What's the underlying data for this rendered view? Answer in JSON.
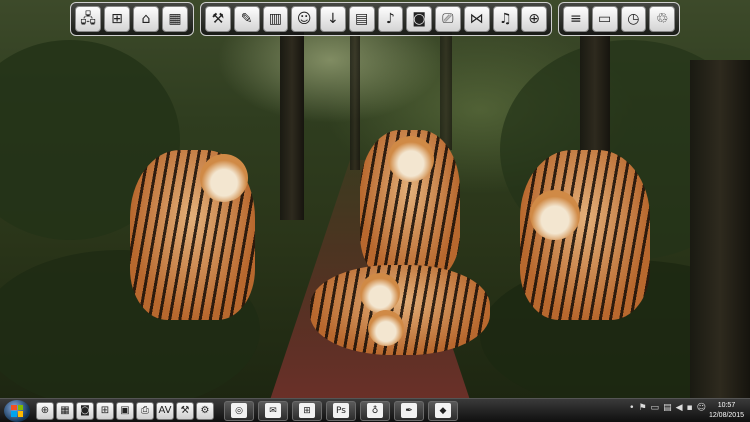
{
  "top_dock": {
    "group1": [
      {
        "name": "computer-icon",
        "glyph": "🖧"
      },
      {
        "name": "network-icon",
        "glyph": "⊞"
      },
      {
        "name": "home-icon",
        "glyph": "⌂"
      },
      {
        "name": "devices-icon",
        "glyph": "▦"
      }
    ],
    "group2": [
      {
        "name": "tools-icon",
        "glyph": "⚒"
      },
      {
        "name": "paint-icon",
        "glyph": "✎"
      },
      {
        "name": "library-icon",
        "glyph": "▥"
      },
      {
        "name": "user-icon",
        "glyph": "☺"
      },
      {
        "name": "downloads-icon",
        "glyph": "↓"
      },
      {
        "name": "documents-icon",
        "glyph": "▤"
      },
      {
        "name": "music-icon",
        "glyph": "♪"
      },
      {
        "name": "camera-icon",
        "glyph": "◙"
      },
      {
        "name": "video-icon",
        "glyph": "⎚"
      },
      {
        "name": "media-player-icon",
        "glyph": "⋈"
      },
      {
        "name": "audio-icon",
        "glyph": "♫"
      },
      {
        "name": "globe-icon",
        "glyph": "⊕"
      }
    ],
    "group3": [
      {
        "name": "menu-icon",
        "glyph": "≡"
      },
      {
        "name": "display-icon",
        "glyph": "▭"
      },
      {
        "name": "gauge-icon",
        "glyph": "◷"
      },
      {
        "name": "recycle-bin-icon",
        "glyph": "♲"
      }
    ]
  },
  "taskbar": {
    "quick_launch": [
      {
        "name": "globe-icon",
        "glyph": "⊕"
      },
      {
        "name": "calculator-icon",
        "glyph": "▦"
      },
      {
        "name": "camera-icon",
        "glyph": "◙"
      },
      {
        "name": "grid-icon",
        "glyph": "⊞"
      },
      {
        "name": "briefcase-icon",
        "glyph": "▣"
      },
      {
        "name": "printer-icon",
        "glyph": "⎙"
      },
      {
        "name": "av-icon",
        "glyph": "AV"
      },
      {
        "name": "tools-icon",
        "glyph": "⚒"
      },
      {
        "name": "settings-icon",
        "glyph": "⚙"
      }
    ],
    "tasks": [
      {
        "name": "browser-icon",
        "glyph": "◎"
      },
      {
        "name": "mail-icon",
        "glyph": "✉"
      },
      {
        "name": "grid-app-icon",
        "glyph": "⊞"
      },
      {
        "name": "photoshop-icon",
        "glyph": "Ps"
      },
      {
        "name": "balloon-icon",
        "glyph": "♁"
      },
      {
        "name": "pen-icon",
        "glyph": "✒"
      },
      {
        "name": "virtualbox-icon",
        "glyph": "◆"
      }
    ],
    "tray": [
      {
        "name": "tray-dot-icon",
        "glyph": "•"
      },
      {
        "name": "flag-icon",
        "glyph": "⚑"
      },
      {
        "name": "tray-window-icon",
        "glyph": "▭"
      },
      {
        "name": "network-status-icon",
        "glyph": "▤"
      },
      {
        "name": "volume-icon",
        "glyph": "◀"
      },
      {
        "name": "tray-app-icon",
        "glyph": "▪"
      },
      {
        "name": "smile-icon",
        "glyph": "☺"
      }
    ],
    "clock": {
      "time": "10:57",
      "date": "12/08/2015"
    }
  }
}
